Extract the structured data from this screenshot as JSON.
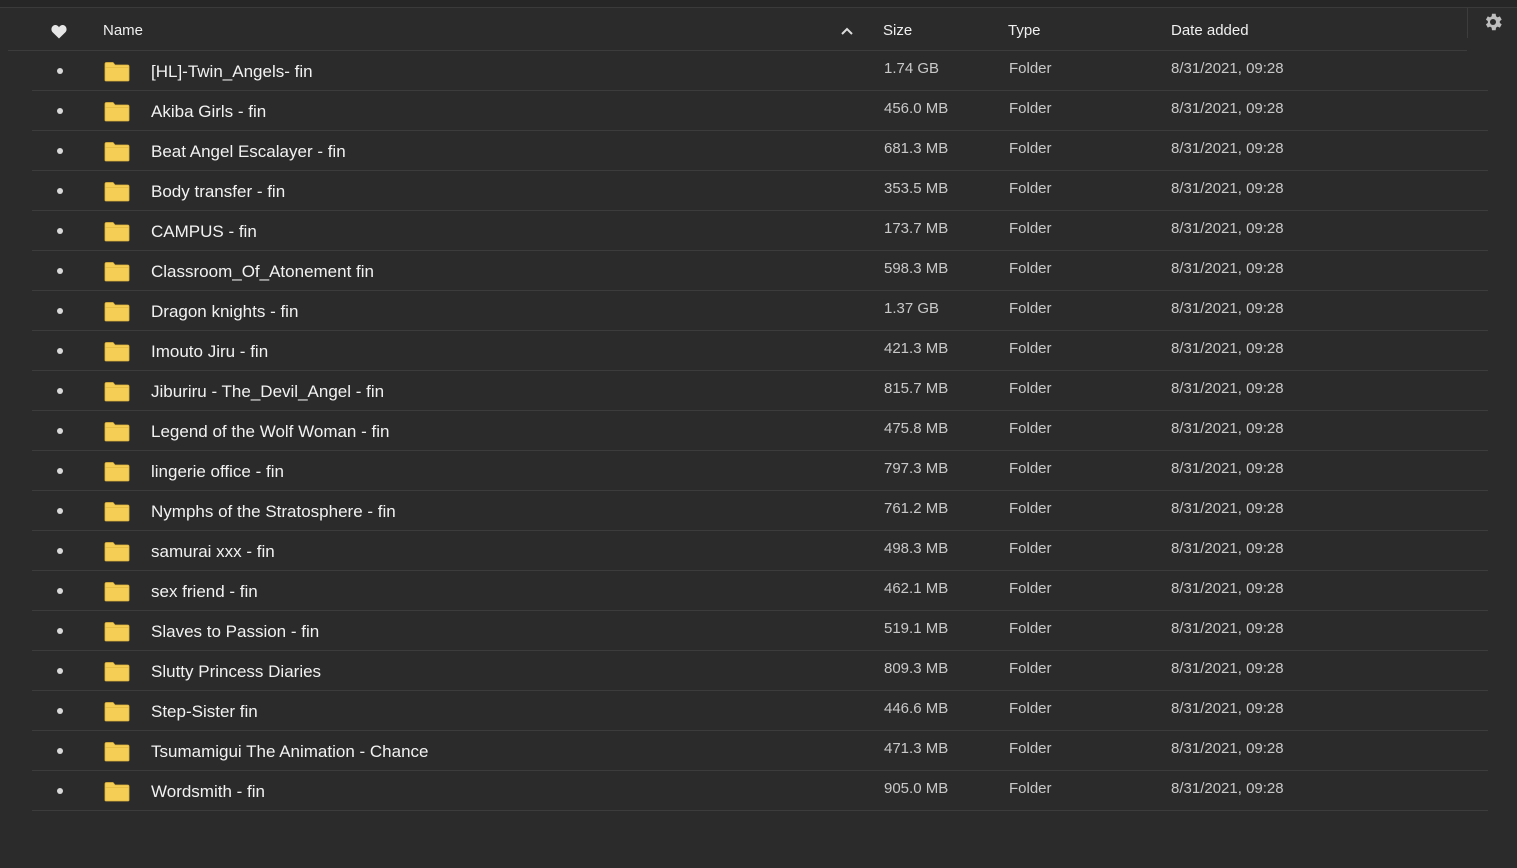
{
  "header": {
    "favorite_icon": "heart-icon",
    "name": "Name",
    "sort_icon": "chevron-up-icon",
    "size": "Size",
    "type": "Type",
    "date_added": "Date added",
    "settings_icon": "gear-icon"
  },
  "colors": {
    "background": "#2b2b2b",
    "folder_fill": "#f5cf55",
    "text": "#f2f2f2",
    "muted_text": "#c9c9c9",
    "divider": "#3c3c3c"
  },
  "rows": [
    {
      "name": "[HL]-Twin_Angels- fin",
      "size": "1.74 GB",
      "type": "Folder",
      "date": "8/31/2021, 09:28"
    },
    {
      "name": "Akiba Girls - fin",
      "size": "456.0 MB",
      "type": "Folder",
      "date": "8/31/2021, 09:28"
    },
    {
      "name": "Beat Angel Escalayer - fin",
      "size": "681.3 MB",
      "type": "Folder",
      "date": "8/31/2021, 09:28"
    },
    {
      "name": "Body transfer - fin",
      "size": "353.5 MB",
      "type": "Folder",
      "date": "8/31/2021, 09:28"
    },
    {
      "name": "CAMPUS - fin",
      "size": "173.7 MB",
      "type": "Folder",
      "date": "8/31/2021, 09:28"
    },
    {
      "name": "Classroom_Of_Atonement fin",
      "size": "598.3 MB",
      "type": "Folder",
      "date": "8/31/2021, 09:28"
    },
    {
      "name": "Dragon knights - fin",
      "size": "1.37 GB",
      "type": "Folder",
      "date": "8/31/2021, 09:28"
    },
    {
      "name": "Imouto Jiru - fin",
      "size": "421.3 MB",
      "type": "Folder",
      "date": "8/31/2021, 09:28"
    },
    {
      "name": "Jiburiru - The_Devil_Angel - fin",
      "size": "815.7 MB",
      "type": "Folder",
      "date": "8/31/2021, 09:28"
    },
    {
      "name": "Legend of the Wolf Woman - fin",
      "size": "475.8 MB",
      "type": "Folder",
      "date": "8/31/2021, 09:28"
    },
    {
      "name": "lingerie office - fin",
      "size": "797.3 MB",
      "type": "Folder",
      "date": "8/31/2021, 09:28"
    },
    {
      "name": "Nymphs of the Stratosphere - fin",
      "size": "761.2 MB",
      "type": "Folder",
      "date": "8/31/2021, 09:28"
    },
    {
      "name": "samurai xxx - fin",
      "size": "498.3 MB",
      "type": "Folder",
      "date": "8/31/2021, 09:28"
    },
    {
      "name": "sex friend - fin",
      "size": "462.1 MB",
      "type": "Folder",
      "date": "8/31/2021, 09:28"
    },
    {
      "name": "Slaves to Passion - fin",
      "size": "519.1 MB",
      "type": "Folder",
      "date": "8/31/2021, 09:28"
    },
    {
      "name": "Slutty Princess Diaries",
      "size": "809.3 MB",
      "type": "Folder",
      "date": "8/31/2021, 09:28"
    },
    {
      "name": "Step-Sister fin",
      "size": "446.6 MB",
      "type": "Folder",
      "date": "8/31/2021, 09:28"
    },
    {
      "name": "Tsumamigui The Animation - Chance",
      "size": "471.3 MB",
      "type": "Folder",
      "date": "8/31/2021, 09:28"
    },
    {
      "name": "Wordsmith - fin",
      "size": "905.0 MB",
      "type": "Folder",
      "date": "8/31/2021, 09:28"
    }
  ]
}
